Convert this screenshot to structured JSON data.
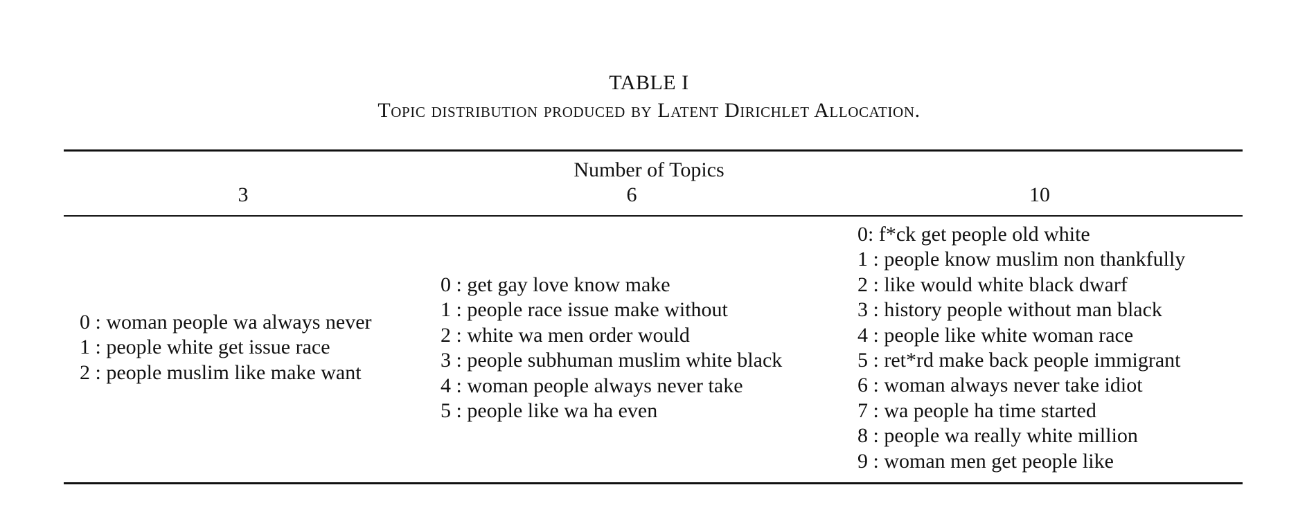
{
  "caption": {
    "label": "TABLE I",
    "text": "Topic distribution produced by Latent Dirichlet Allocation."
  },
  "table": {
    "group_header": "Number of Topics",
    "columns": [
      {
        "header": "3",
        "topics": [
          "0 : woman people wa always never",
          "1 : people white get issue race",
          "2 : people muslim like make want"
        ]
      },
      {
        "header": "6",
        "topics": [
          "0 : get gay love know make",
          "1 : people race issue make without",
          "2 : white wa men order would",
          "3 : people subhuman muslim white black",
          "4 : woman people always never take",
          "5 : people like wa ha even"
        ]
      },
      {
        "header": "10",
        "topics": [
          "0: f*ck get people old white",
          "1 : people know muslim non thankfully",
          "2 : like would white black dwarf",
          "3 : history people without man black",
          "4 : people like white woman race",
          "5 : ret*rd make back people immigrant",
          "6 : woman always never take idiot",
          "7 : wa people ha time started",
          "8 : people wa really white million",
          "9 : woman men get people like"
        ]
      }
    ]
  }
}
